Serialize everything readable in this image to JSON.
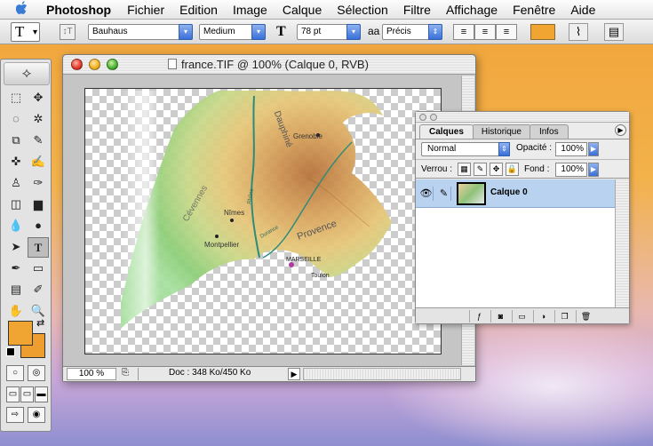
{
  "menubar": {
    "apple_icon": "apple-icon",
    "app_name": "Photoshop",
    "items": [
      "Fichier",
      "Edition",
      "Image",
      "Calque",
      "Sélection",
      "Filtre",
      "Affichage",
      "Fenêtre",
      "Aide"
    ]
  },
  "options_bar": {
    "tool_glyph": "T",
    "orientation_glyph": "↕T",
    "font_family": "Bauhaus",
    "font_style": "Medium",
    "size_glyph": "T",
    "font_size": "78 pt",
    "aa_glyph": "aa",
    "antialias": "Précis",
    "text_color": "#f0a533"
  },
  "toolbox": {
    "tools": [
      "⬚",
      "✥",
      "◌",
      "✲",
      "⧉",
      "✎",
      "✜",
      "✍",
      "♙",
      "✑",
      "◫",
      "▆",
      "💧",
      "●",
      "➤",
      "T",
      "✒",
      "▭",
      "▤",
      "✐",
      "✋",
      "🔍"
    ],
    "selected_index": 15,
    "foreground_color": "#f0a533",
    "background_color": "#ee9e2e"
  },
  "document": {
    "title": "france.TIF @ 100% (Calque 0, RVB)",
    "zoom": "100 %",
    "doc_info": "Doc : 348 Ko/450 Ko",
    "map_labels": {
      "grenoble": "Grenoble",
      "dauphine": "Dauphiné",
      "cevennes": "Cévennes",
      "nimes": "Nîmes",
      "montpellier": "Montpellier",
      "provence": "Provence",
      "durance": "Durance",
      "marseille": "MARSEILLE",
      "toulon": "Toulon",
      "rhone": "Rhône"
    }
  },
  "layers_palette": {
    "tabs": [
      "Calques",
      "Historique",
      "Infos"
    ],
    "active_tab": "Calques",
    "blend_mode": "Normal",
    "opacity_label": "Opacité :",
    "opacity": "100%",
    "lock_label": "Verrou :",
    "fill_label": "Fond :",
    "fill": "100%",
    "layers": [
      {
        "name": "Calque 0",
        "visible": true,
        "selected": true
      }
    ]
  }
}
